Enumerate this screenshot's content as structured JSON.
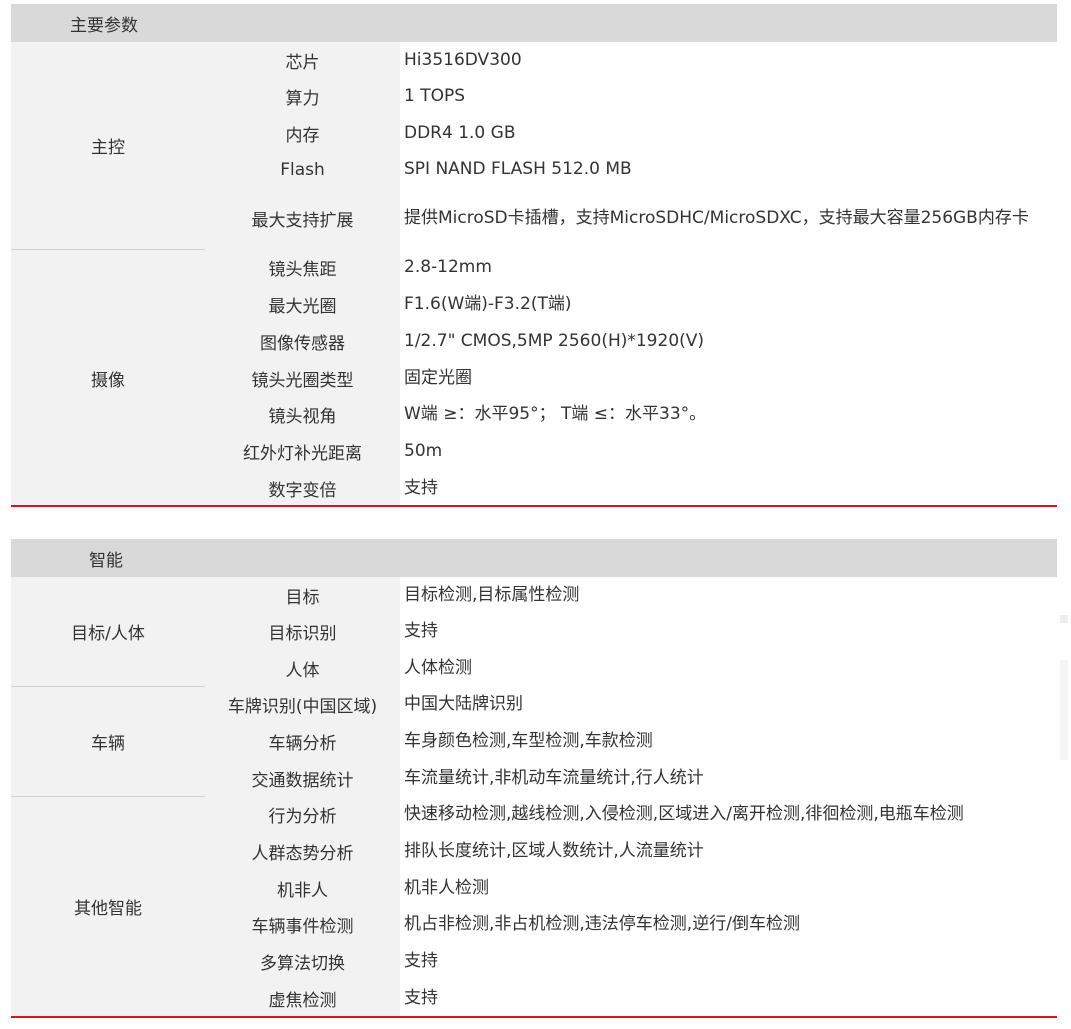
{
  "sections": [
    {
      "title": "主要参数",
      "groups": [
        {
          "name": "主控",
          "rows": [
            {
              "label": "芯片",
              "value": "Hi3516DV300"
            },
            {
              "label": "算力",
              "value": "1 TOPS"
            },
            {
              "label": "内存",
              "value": "DDR4 1.0 GB"
            },
            {
              "label": "Flash",
              "value": "SPI NAND FLASH 512.0 MB"
            },
            {
              "label": "最大支持扩展",
              "value": "提供MicroSD卡插槽，支持MicroSDHC/MicroSDXC，支持最大容量256GB内存卡"
            }
          ]
        },
        {
          "name": "摄像",
          "rows": [
            {
              "label": "镜头焦距",
              "value": "2.8-12mm"
            },
            {
              "label": "最大光圈",
              "value": "F1.6(W端)-F3.2(T端)"
            },
            {
              "label": "图像传感器",
              "value": "1/2.7\" CMOS,5MP 2560(H)*1920(V)"
            },
            {
              "label": "镜头光圈类型",
              "value": "固定光圈"
            },
            {
              "label": "镜头视角",
              "value": "W端 ≥：水平95°； T端 ≤：水平33°。"
            },
            {
              "label": "红外灯补光距离",
              "value": "50m"
            },
            {
              "label": "数字变倍",
              "value": "支持"
            }
          ]
        }
      ]
    },
    {
      "title": "智能",
      "groups": [
        {
          "name": "目标/人体",
          "rows": [
            {
              "label": "目标",
              "value": "目标检测,目标属性检测"
            },
            {
              "label": "目标识别",
              "value": "支持"
            },
            {
              "label": "人体",
              "value": "人体检测"
            }
          ]
        },
        {
          "name": "车辆",
          "rows": [
            {
              "label": "车牌识别(中国区域)",
              "value": "中国大陆牌识别"
            },
            {
              "label": "车辆分析",
              "value": "车身颜色检测,车型检测,车款检测"
            },
            {
              "label": "交通数据统计",
              "value": "车流量统计,非机动车流量统计,行人统计"
            }
          ]
        },
        {
          "name": "其他智能",
          "rows": [
            {
              "label": "行为分析",
              "value": "快速移动检测,越线检测,入侵检测,区域进入/离开检测,徘徊检测,电瓶车检测"
            },
            {
              "label": "人群态势分析",
              "value": "排队长度统计,区域人数统计,人流量统计"
            },
            {
              "label": "机非人",
              "value": "机非人检测"
            },
            {
              "label": "车辆事件检测",
              "value": "机占非检测,非占机检测,违法停车检测,逆行/倒车检测"
            },
            {
              "label": "多算法切换",
              "value": "支持"
            },
            {
              "label": "虚焦检测",
              "value": "支持"
            }
          ]
        }
      ]
    }
  ]
}
